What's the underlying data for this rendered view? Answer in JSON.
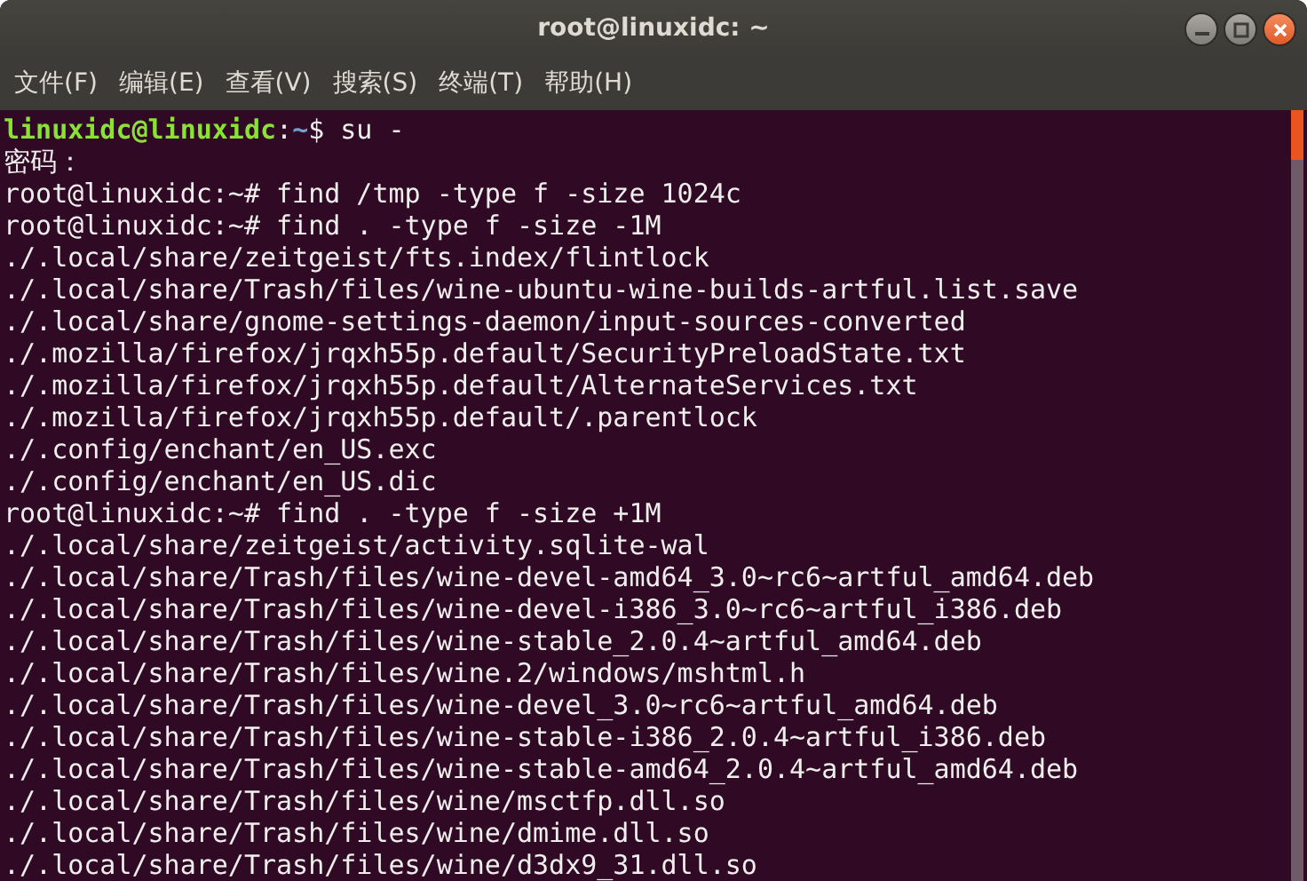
{
  "window": {
    "title": "root@linuxidc: ~"
  },
  "menu": [
    "文件(F)",
    "编辑(E)",
    "查看(V)",
    "搜索(S)",
    "终端(T)",
    "帮助(H)"
  ],
  "terminal": {
    "lines": [
      {
        "kind": "prompt",
        "segments": [
          {
            "kind": "user",
            "text": "linuxidc@linuxidc"
          },
          {
            "kind": "plain",
            "text": ":"
          },
          {
            "kind": "path",
            "text": "~"
          },
          {
            "kind": "plain",
            "text": "$ su -"
          }
        ]
      },
      {
        "kind": "text",
        "text": "密码："
      },
      {
        "kind": "text",
        "text": "root@linuxidc:~# find /tmp -type f -size 1024c"
      },
      {
        "kind": "text",
        "text": "root@linuxidc:~# find . -type f -size -1M"
      },
      {
        "kind": "text",
        "text": "./.local/share/zeitgeist/fts.index/flintlock"
      },
      {
        "kind": "text",
        "text": "./.local/share/Trash/files/wine-ubuntu-wine-builds-artful.list.save"
      },
      {
        "kind": "text",
        "text": "./.local/share/gnome-settings-daemon/input-sources-converted"
      },
      {
        "kind": "text",
        "text": "./.mozilla/firefox/jrqxh55p.default/SecurityPreloadState.txt"
      },
      {
        "kind": "text",
        "text": "./.mozilla/firefox/jrqxh55p.default/AlternateServices.txt"
      },
      {
        "kind": "text",
        "text": "./.mozilla/firefox/jrqxh55p.default/.parentlock"
      },
      {
        "kind": "text",
        "text": "./.config/enchant/en_US.exc"
      },
      {
        "kind": "text",
        "text": "./.config/enchant/en_US.dic"
      },
      {
        "kind": "text",
        "text": "root@linuxidc:~# find . -type f -size +1M"
      },
      {
        "kind": "text",
        "text": "./.local/share/zeitgeist/activity.sqlite-wal"
      },
      {
        "kind": "text",
        "text": "./.local/share/Trash/files/wine-devel-amd64_3.0~rc6~artful_amd64.deb"
      },
      {
        "kind": "text",
        "text": "./.local/share/Trash/files/wine-devel-i386_3.0~rc6~artful_i386.deb"
      },
      {
        "kind": "text",
        "text": "./.local/share/Trash/files/wine-stable_2.0.4~artful_amd64.deb"
      },
      {
        "kind": "text",
        "text": "./.local/share/Trash/files/wine.2/windows/mshtml.h"
      },
      {
        "kind": "text",
        "text": "./.local/share/Trash/files/wine-devel_3.0~rc6~artful_amd64.deb"
      },
      {
        "kind": "text",
        "text": "./.local/share/Trash/files/wine-stable-i386_2.0.4~artful_i386.deb"
      },
      {
        "kind": "text",
        "text": "./.local/share/Trash/files/wine-stable-amd64_2.0.4~artful_amd64.deb"
      },
      {
        "kind": "text",
        "text": "./.local/share/Trash/files/wine/msctfp.dll.so"
      },
      {
        "kind": "text",
        "text": "./.local/share/Trash/files/wine/dmime.dll.so"
      },
      {
        "kind": "text",
        "text": "./.local/share/Trash/files/wine/d3dx9_31.dll.so"
      }
    ]
  }
}
